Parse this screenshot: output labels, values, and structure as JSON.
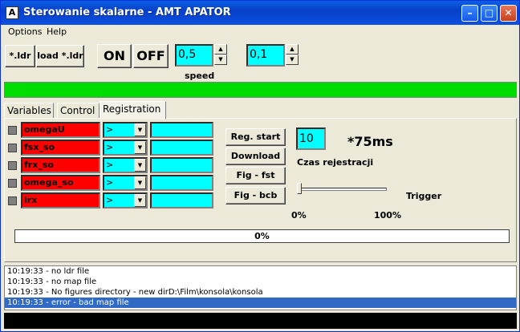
{
  "window": {
    "title": "Sterowanie skalarne - AMT APATOR",
    "icon_letter": "A"
  },
  "menu": [
    "Options",
    "Help"
  ],
  "toolbar": {
    "ldr_label": "*.ldr",
    "load_label": "load *.ldr",
    "on_label": "ON",
    "off_label": "OFF",
    "spin1_value": "0,5",
    "spin2_value": "0,1"
  },
  "speed": {
    "label": "speed",
    "level": 1.0
  },
  "tabs": [
    "Variables",
    "Control",
    "Registration"
  ],
  "active_tab": "Registration",
  "variables": [
    {
      "name": "omegaU",
      "op": ">",
      "value": ""
    },
    {
      "name": "fsx_so",
      "op": ">",
      "value": ""
    },
    {
      "name": "frx_so",
      "op": ">",
      "value": ""
    },
    {
      "name": "omega_so",
      "op": ">",
      "value": ""
    },
    {
      "name": "irx",
      "op": ">",
      "value": ""
    }
  ],
  "buttons": [
    "Reg. start",
    "Download",
    "Fig - fst",
    "Fig - bcb"
  ],
  "czas": {
    "value": "10",
    "unit": "*75ms",
    "label": "Czas rejestracji"
  },
  "trigger": {
    "label": "Trigger",
    "min": "0%",
    "max": "100%",
    "level": 0
  },
  "progress": {
    "text": "0%",
    "level": 0
  },
  "log": [
    "10:19:33 - no ldr file",
    "10:19:33 - no map file",
    "10:19:33 - No figures directory - new dirD:\\Film\\konsola\\konsola",
    "10:19:33 - error - bad map file"
  ],
  "log_selected": 3,
  "colors": {
    "accent_cyan": "#00ffff",
    "var_red": "#ff0000",
    "speed_green": "#00dd00",
    "selection": "#316ac5"
  }
}
